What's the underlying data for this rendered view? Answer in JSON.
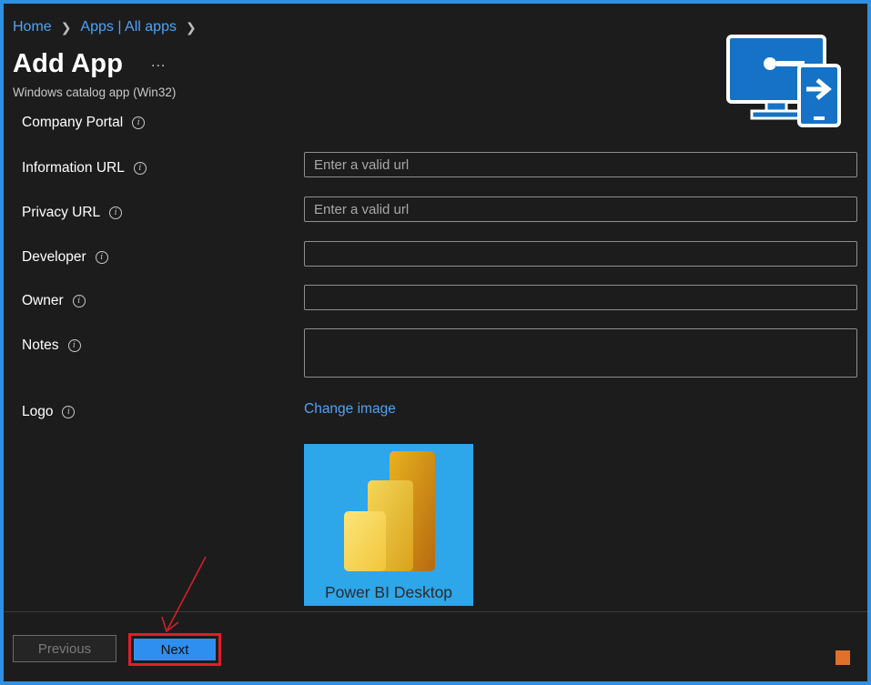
{
  "breadcrumb": {
    "home": "Home",
    "apps": "Apps | All apps"
  },
  "header": {
    "title": "Add App",
    "more": "...",
    "subtitle": "Windows catalog app (Win32)"
  },
  "form": {
    "company_portal_label": "Company Portal",
    "information_url": {
      "label": "Information URL",
      "placeholder": "Enter a valid url",
      "value": ""
    },
    "privacy_url": {
      "label": "Privacy URL",
      "placeholder": "Enter a valid url",
      "value": ""
    },
    "developer": {
      "label": "Developer",
      "value": ""
    },
    "owner": {
      "label": "Owner",
      "value": ""
    },
    "notes": {
      "label": "Notes",
      "value": ""
    },
    "logo": {
      "label": "Logo",
      "change_link": "Change image",
      "caption": "Power BI Desktop"
    }
  },
  "footer": {
    "previous": "Previous",
    "next": "Next"
  },
  "colors": {
    "accent": "#2e8ff0",
    "link": "#4fa3f5",
    "highlight": "#e01e2a",
    "logo_bg": "#2ea6ea"
  },
  "icons": [
    "chevron-right-icon",
    "info-icon",
    "ellipsis-icon",
    "remote-desktop-icon",
    "power-bi-logo",
    "annotation-arrow"
  ]
}
